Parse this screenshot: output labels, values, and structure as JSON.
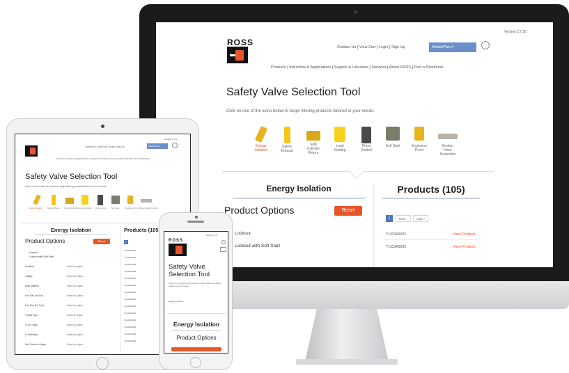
{
  "site": {
    "version": "Version 2.7.16",
    "nav_top": [
      "Contact Us",
      "View Cart",
      "Login",
      "Sign Up"
    ],
    "search_placeholder": "Model/Part #",
    "nav_main": [
      "Products",
      "Industries & Applications",
      "Support & Literature",
      "Services",
      "About ROSS",
      "Find a Distributor"
    ],
    "logo_text": "ROSS",
    "title": "Safety Valve Selection Tool",
    "title_mobile_line1": "Safety Valve",
    "title_mobile_line2": "Selection Tool",
    "description": "Click on one of the icons below to begin filtering products tailored to your needs.",
    "icons": [
      {
        "label": "Energy Isolation",
        "label_l1": "Energy",
        "label_l2": "Isolation",
        "label_l3": "",
        "selected": true,
        "color": "#e8b31f"
      },
      {
        "label": "Safety Exhaust",
        "label_l1": "Safety",
        "label_l2": "Exhaust",
        "label_l3": "",
        "selected": false,
        "color": "#f2c61a"
      },
      {
        "label": "Safe Cylinder Return",
        "label_l1": "Safe",
        "label_l2": "Cylinder",
        "label_l3": "Return",
        "selected": false,
        "color": "#d8a81a"
      },
      {
        "label": "Load Holding",
        "label_l1": "Load",
        "label_l2": "Holding",
        "label_l3": "",
        "selected": false,
        "color": "#f5d21e"
      },
      {
        "label": "Press Control",
        "label_l1": "Press",
        "label_l2": "Control",
        "label_l3": "",
        "selected": false,
        "color": "#4a4a4a"
      },
      {
        "label": "Soft Start",
        "label_l1": "Soft Start",
        "label_l2": "",
        "label_l3": "",
        "selected": false,
        "color": "#7c7c6a"
      },
      {
        "label": "Explosion Proof",
        "label_l1": "Explosion",
        "label_l2": "Proof",
        "label_l3": "",
        "selected": false,
        "color": "#e8b31f"
      },
      {
        "label": "Broken Hose Protection",
        "label_l1": "Broken",
        "label_l2": "Hose",
        "label_l3": "Protection",
        "selected": false,
        "color": "#b9b2a8"
      }
    ],
    "section_left": "Energy Isolation",
    "product_options": "Product Options",
    "reset": "Reset",
    "options": [
      "Lockout",
      "Lockout with Soft Start"
    ],
    "products_heading": "Products (105)",
    "products_heading_tablet": "Products (105)",
    "pagination": {
      "current": "1",
      "next": "Next ›",
      "last": "Last »"
    },
    "view_product": "View Product",
    "rows": [
      "Y1323A3003",
      "Y1323A3003"
    ],
    "filter_labels": [
      "Actuation",
      "Voltage",
      "Body Material",
      "Port Size (IN Port)",
      "Port Size (EX Port)",
      "Thread Type",
      "In-Lin / Bspp",
      "Fr-Barksdale",
      "Inlet Pressure Range"
    ],
    "filter_value": "Select an option",
    "tablet_products_label": "Y1323A3003",
    "mobile_section": "Energy Isolation"
  }
}
